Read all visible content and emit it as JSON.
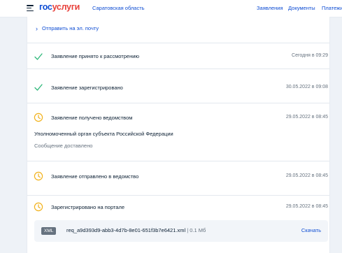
{
  "header": {
    "logo_part1": "гос",
    "logo_part2": "услуги",
    "region": "Саратовская область",
    "nav": [
      "Заявления",
      "Документы",
      "Платежи"
    ]
  },
  "send_email_link": "Отправить на эл. почту",
  "statuses": [
    {
      "title": "Заявление принято к рассмотрению",
      "date": "Сегодня в 09:29",
      "icon": "check-icon"
    },
    {
      "title": "Заявление зарегистрировано",
      "date": "30.05.2022 в 09:08",
      "icon": "check-icon"
    },
    {
      "title": "Заявление получено ведомством",
      "date": "29.05.2022 в 08:45",
      "icon": "clock-icon",
      "detail": "Уполномоченный орган субъекта Российской Федерации",
      "note": "Сообщение доставлено"
    },
    {
      "title": "Заявление отправлено в ведомство",
      "date": "29.05.2022 в 08:45",
      "icon": "clock-icon"
    },
    {
      "title": "Зарегистрировано на портале",
      "date": "29.05.2022 в 08:45",
      "icon": "clock-icon"
    }
  ],
  "file": {
    "type": "XML",
    "name": "req_a9d393d9-abb3-4d7b-8e01-651f3b7e6421.xml",
    "separator": "|",
    "size": "0.1 Мб",
    "download_label": "Скачать"
  },
  "colors": {
    "brand_blue": "#0d4cd3",
    "brand_red": "#e8413b",
    "check_green": "#2eb87a",
    "clock_orange": "#f2b21c",
    "muted": "#66727f"
  }
}
